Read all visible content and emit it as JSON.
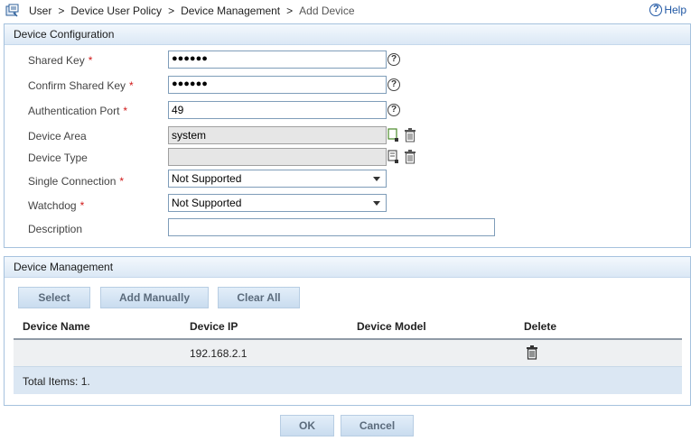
{
  "breadcrumb": {
    "items": [
      "User",
      "Device User Policy",
      "Device Management",
      "Add Device"
    ],
    "separator": ">"
  },
  "help": {
    "label": "Help",
    "icon": "question-circle-icon"
  },
  "device_configuration": {
    "title": "Device Configuration",
    "required_mark": "*",
    "fields": {
      "shared_key": {
        "label": "Shared Key",
        "value": "●●●●●●",
        "required": true
      },
      "confirm_shared_key": {
        "label": "Confirm Shared Key",
        "value": "●●●●●●",
        "required": true
      },
      "authentication_port": {
        "label": "Authentication Port",
        "value": "49",
        "required": true
      },
      "device_area": {
        "label": "Device Area",
        "value": "system"
      },
      "device_type": {
        "label": "Device Type",
        "value": ""
      },
      "single_connection": {
        "label": "Single Connection",
        "value": "Not Supported",
        "required": true
      },
      "watchdog": {
        "label": "Watchdog",
        "value": "Not Supported",
        "required": true
      },
      "description": {
        "label": "Description",
        "value": ""
      }
    }
  },
  "device_management": {
    "title": "Device Management",
    "buttons": {
      "select": "Select",
      "add_manually": "Add Manually",
      "clear_all": "Clear All"
    },
    "columns": [
      "Device Name",
      "Device IP",
      "Device Model",
      "Delete"
    ],
    "rows": [
      {
        "device_name": "",
        "device_ip": "192.168.2.1",
        "device_model": "",
        "delete_icon": "trash-icon"
      }
    ],
    "total": "Total Items: 1."
  },
  "footer": {
    "ok": "OK",
    "cancel": "Cancel"
  },
  "colors": {
    "panel_border": "#a6c2de",
    "header_bg": "#dbe8f5",
    "required": "#d01818",
    "link": "#1f57a4"
  }
}
